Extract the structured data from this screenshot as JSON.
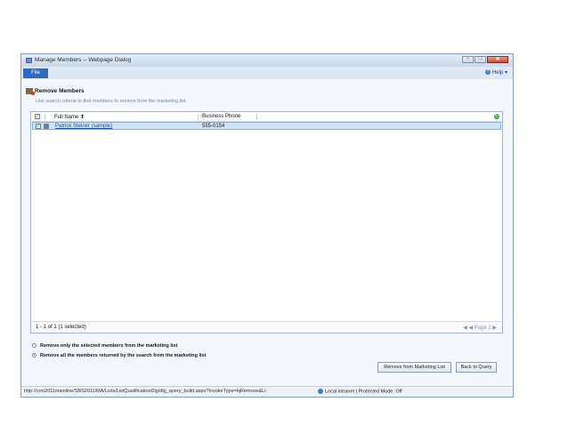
{
  "window": {
    "title": "Manage Members -- Webpage Dialog",
    "controls": {
      "minimize": "–",
      "maximize": "□",
      "close": "✕"
    }
  },
  "menubar": {
    "file_tab": "File",
    "help": "Help ▾"
  },
  "section": {
    "heading": "Remove Members",
    "subtitle": "Use search criteria to find members to remove from the marketing list."
  },
  "grid": {
    "columns": [
      "Full Name ⬆",
      "Business Phone"
    ],
    "rows": [
      {
        "full_name": "Patrick Steiner (sample)",
        "business_phone": "555-0154"
      }
    ],
    "footer_count": "1 - 1 of 1 (1 selected)",
    "footer_pager": "◀ ◀ Page 1 ▶"
  },
  "options": {
    "remove_selected": "Remove only the selected members from the marketing list",
    "remove_all": "Remove all the members returned by the search from the marketing list"
  },
  "buttons": {
    "remove_from_list": "Remove from Marketing List",
    "back_to_query": "Back to Query"
  },
  "status": {
    "url": "http://crm2011mainline/SBS2011/MA/Lists/ListQualificationDlg/dlg_query_build.aspx?InvokeType=lqRemove&Li:",
    "zone": "Local intranet | Protected Mode: Off"
  }
}
